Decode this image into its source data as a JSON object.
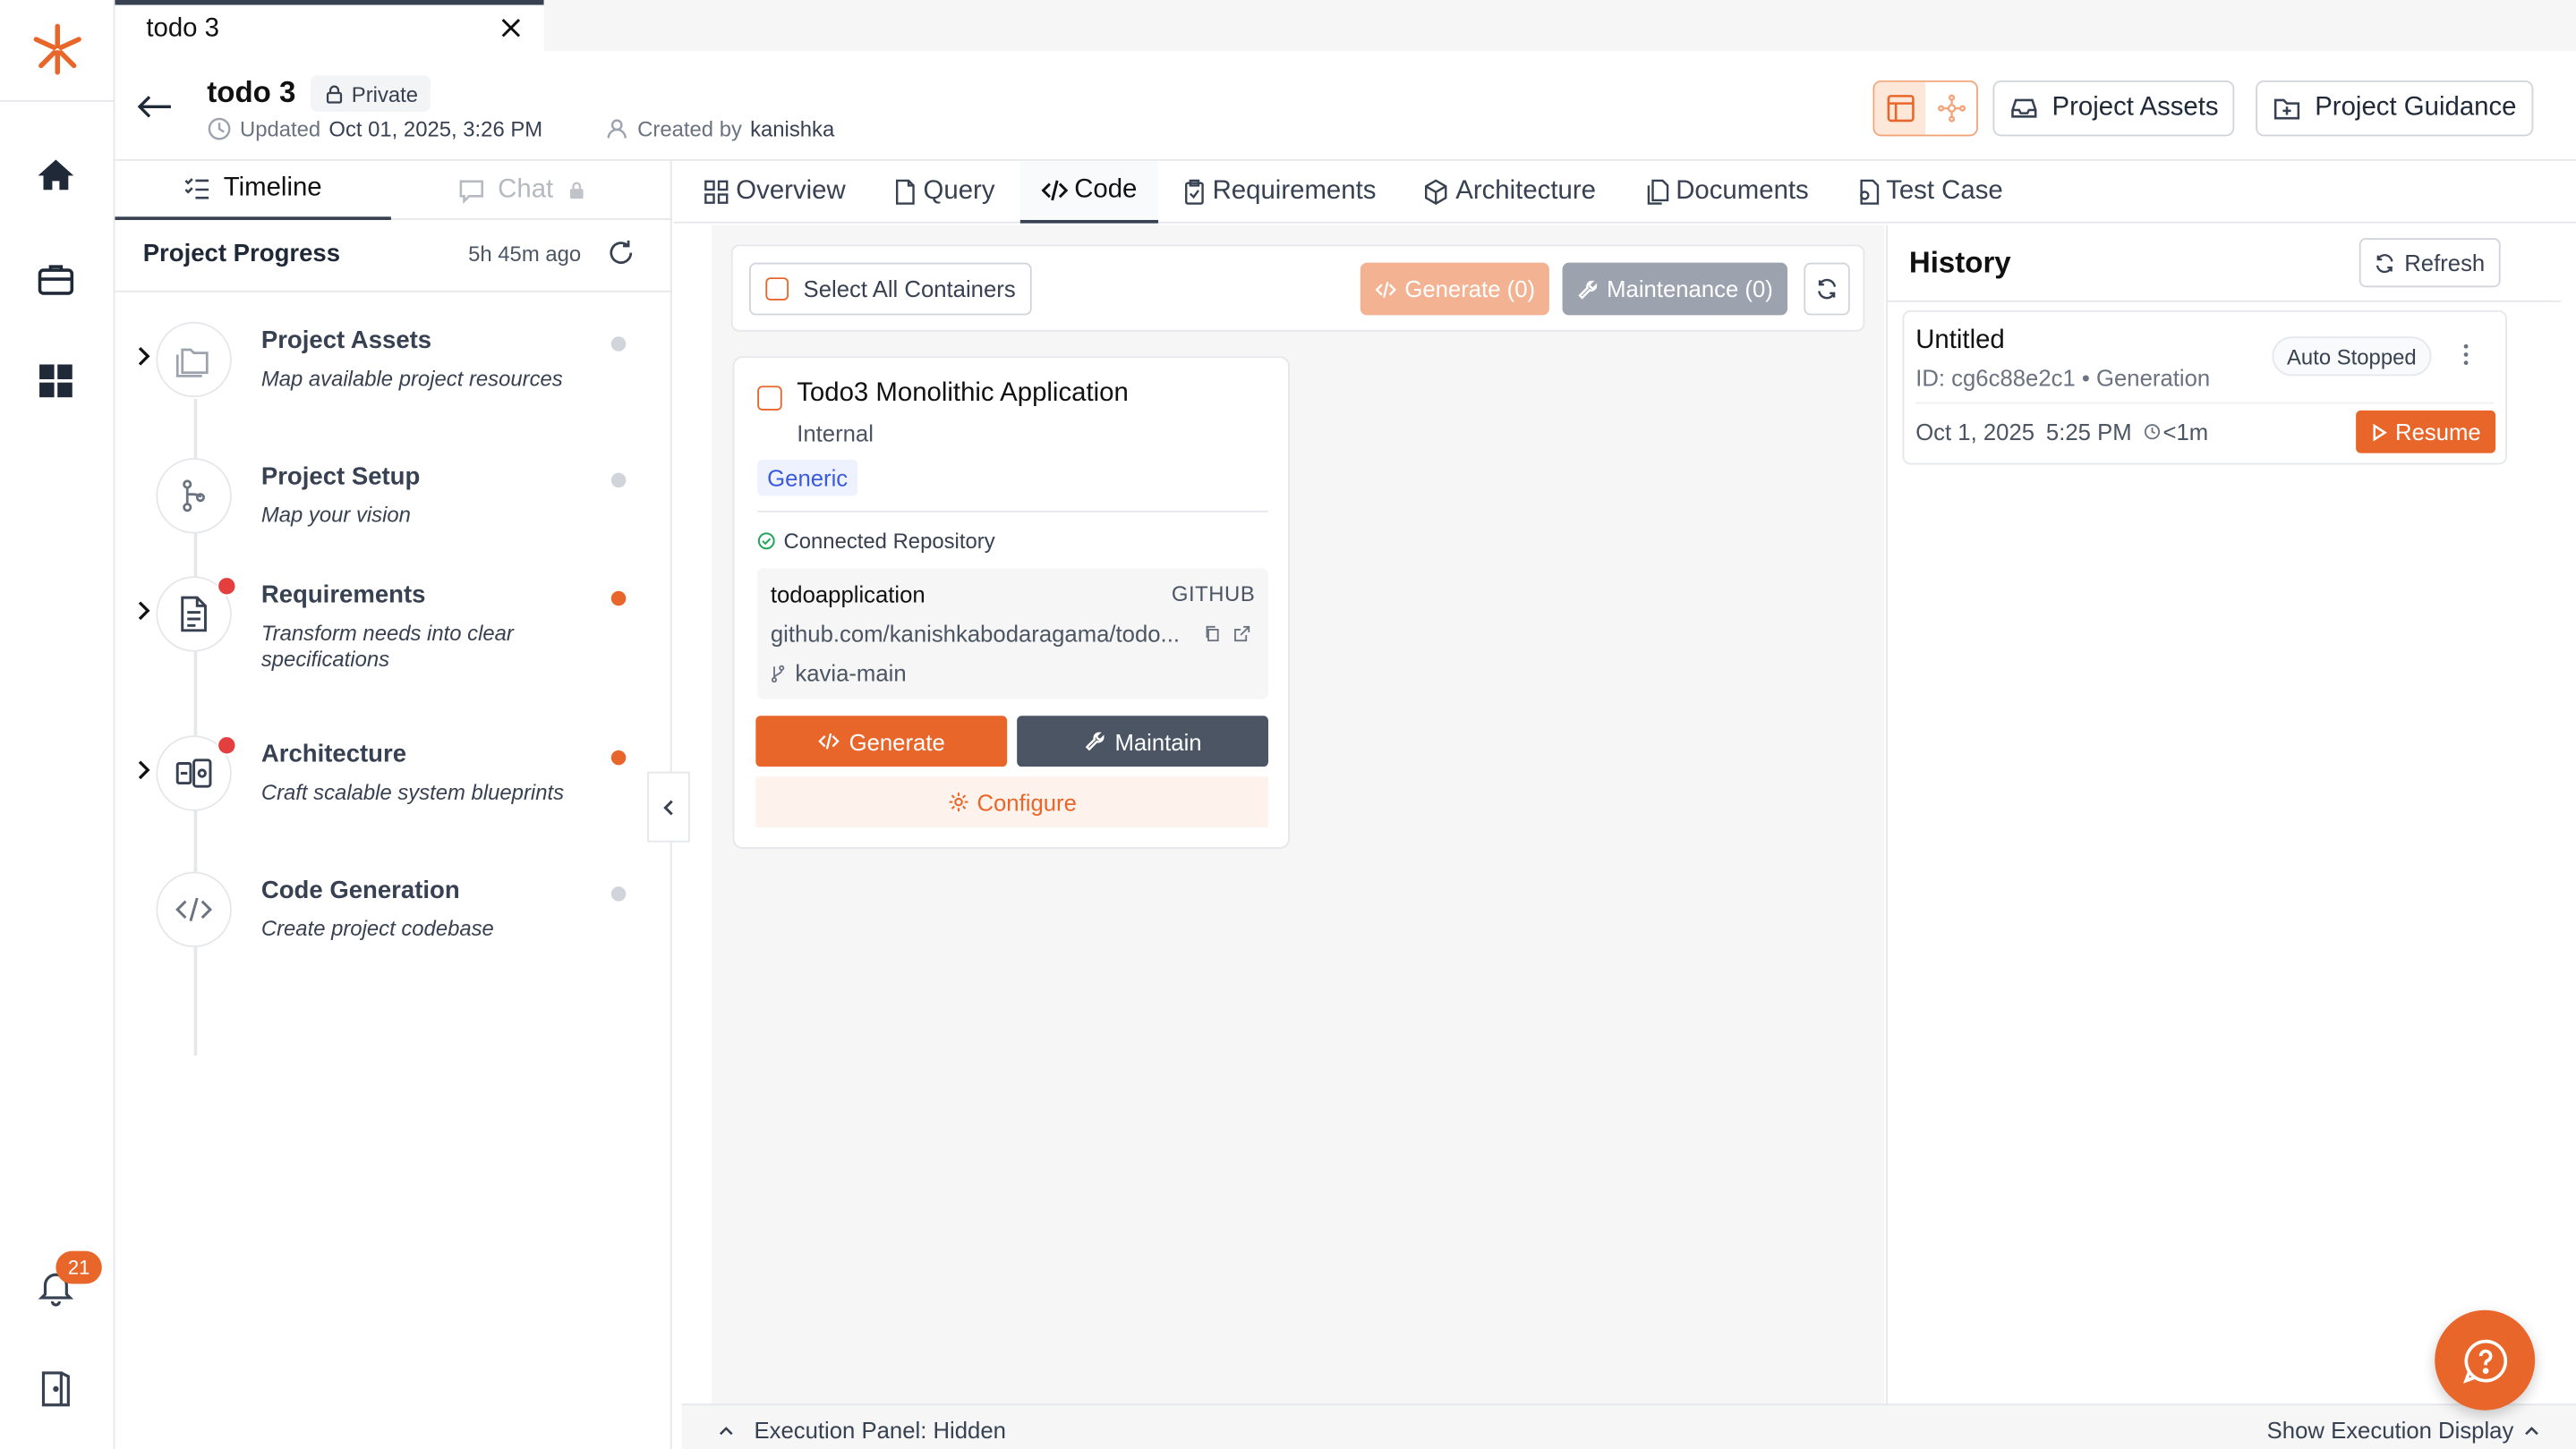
{
  "tab": {
    "title": "todo 3"
  },
  "header": {
    "project_name": "todo 3",
    "visibility": "Private",
    "updated_label": "Updated",
    "updated_value": "Oct 01, 2025, 3:26 PM",
    "created_label": "Created by",
    "created_value": "kanishka",
    "project_assets_button": "Project Assets",
    "project_guidance_button": "Project Guidance"
  },
  "rail": {
    "notification_count": "21"
  },
  "left_panel": {
    "tabs": {
      "timeline": "Timeline",
      "chat": "Chat"
    },
    "progress_title": "Project Progress",
    "progress_time": "5h 45m ago",
    "steps": [
      {
        "name": "Project Assets",
        "desc": "Map available project resources"
      },
      {
        "name": "Project Setup",
        "desc": "Map your vision"
      },
      {
        "name": "Requirements",
        "desc": "Transform needs into clear specifications"
      },
      {
        "name": "Architecture",
        "desc": "Craft scalable system blueprints"
      },
      {
        "name": "Code Generation",
        "desc": "Create project codebase"
      }
    ]
  },
  "content_tabs": [
    "Overview",
    "Query",
    "Code",
    "Requirements",
    "Architecture",
    "Documents",
    "Test Case"
  ],
  "toolbar": {
    "select_all": "Select All Containers",
    "generate": "Generate (0)",
    "maintenance": "Maintenance (0)"
  },
  "container": {
    "title": "Todo3 Monolithic Application",
    "subtitle": "Internal",
    "tag": "Generic",
    "connected_label": "Connected Repository",
    "repo_name": "todoapplication",
    "repo_host": "GITHUB",
    "repo_url": "github.com/kanishkabodaragama/todo...",
    "branch": "kavia-main",
    "generate": "Generate",
    "maintain": "Maintain",
    "configure": "Configure"
  },
  "history": {
    "title": "History",
    "refresh": "Refresh",
    "item": {
      "name": "Untitled",
      "id_line": "ID: cg6c88e2c1 • Generation",
      "status": "Auto Stopped",
      "date": "Oct 1, 2025",
      "time": "5:25 PM",
      "duration": "<1m",
      "resume": "Resume"
    }
  },
  "bottom": {
    "left": "Execution Panel: Hidden",
    "right": "Show Execution Display"
  },
  "colors": {
    "accent": "#e8662a",
    "dark_button": "#4b5563",
    "step_dot_active": "#e8662a",
    "alert_dot": "#e53e3e"
  }
}
